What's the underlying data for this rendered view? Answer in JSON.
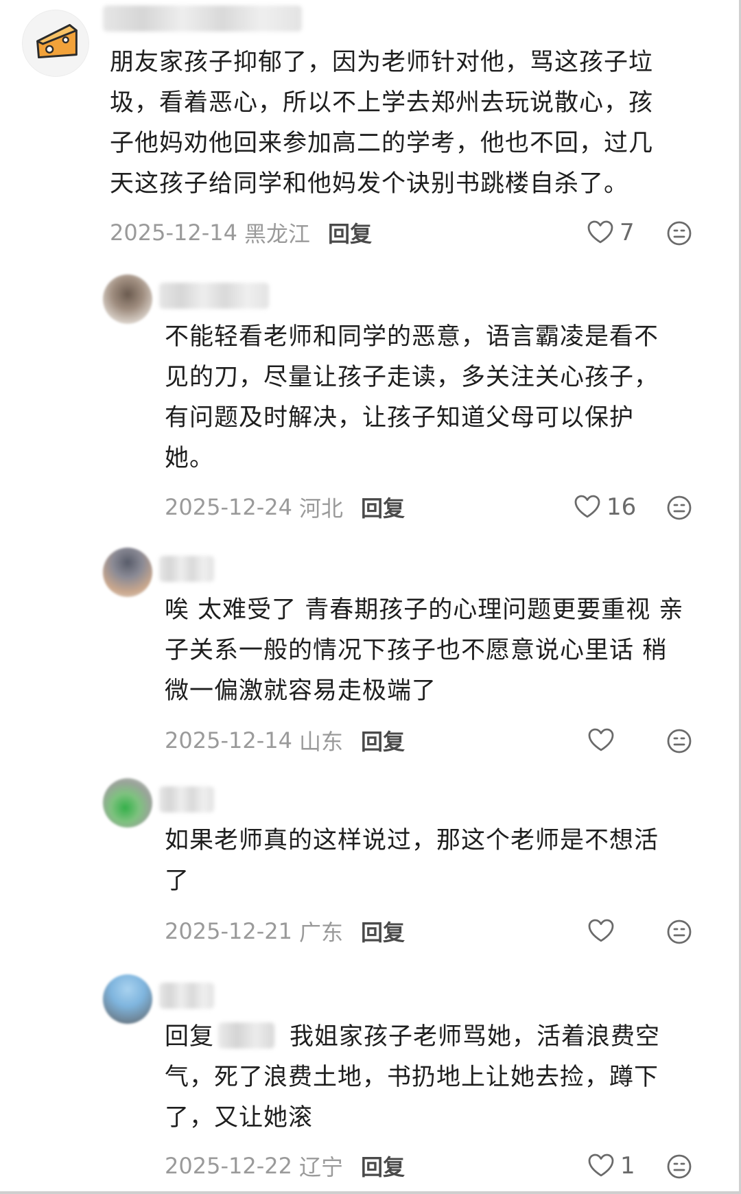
{
  "comments": [
    {
      "text": "朋友家孩子抑郁了，因为老师针对他，骂这孩子垃\n圾，看着恶心，所以不上学去郑州去玩说散心，孩\n子他妈劝他回来参加高二的学考，他也不回，过几\n天这孩子给同学和他妈发个诀别书跳楼自杀了。",
      "date": "2025-12-14",
      "region": "黑龙江",
      "reply_label": "回复",
      "likes": "7",
      "avatar_icon": "cheese-avatar-icon"
    },
    {
      "text": "不能轻看老师和同学的恶意，语言霸凌是看不\n见的刀，尽量让孩子走读，多关注关心孩子，\n有问题及时解决，让孩子知道父母可以保护\n她。",
      "date": "2025-12-24",
      "region": "河北",
      "reply_label": "回复",
      "likes": "16"
    },
    {
      "text": "唉 太难受了 青春期孩子的心理问题更要重视 亲\n子关系一般的情况下孩子也不愿意说心里话 稍\n微一偏激就容易走极端了",
      "date": "2025-12-14",
      "region": "山东",
      "reply_label": "回复",
      "likes": ""
    },
    {
      "text": "如果老师真的这样说过，那这个老师是不想活\n了",
      "date": "2025-12-21",
      "region": "广东",
      "reply_label": "回复",
      "likes": ""
    },
    {
      "reply_prefix": "回复",
      "text_line1": "我姐家孩子老师骂她，活着浪费空",
      "text_rest": "气，死了浪费土地，书扔地上让她去捡，蹲下\n了，又让她滚",
      "date": "2025-12-22",
      "region": "辽宁",
      "reply_label": "回复",
      "likes": "1"
    }
  ],
  "colors": {
    "text": "#1e1e1e",
    "meta": "#9a9a9a",
    "reply_button": "#4a4a4a",
    "icon": "#6a6a6a",
    "cheese": "#f2a23a"
  }
}
